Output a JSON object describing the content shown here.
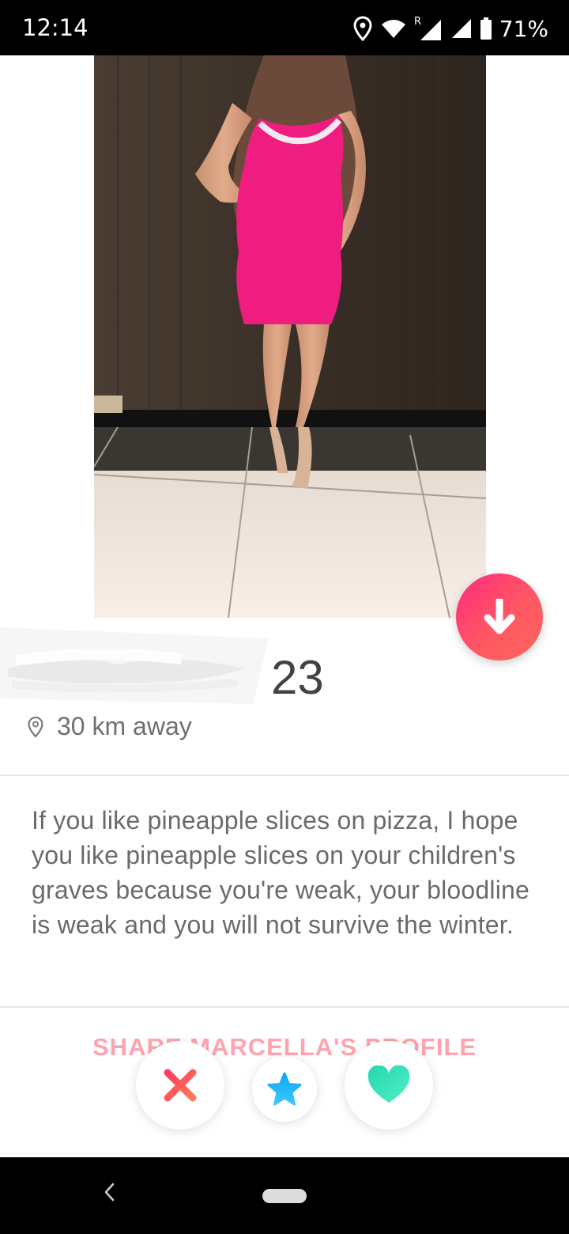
{
  "status_bar": {
    "time": "12:14",
    "battery": "71%",
    "icons": [
      "location-icon",
      "wifi-icon",
      "signal-roaming-icon",
      "signal-icon",
      "battery-icon"
    ]
  },
  "profile": {
    "photo": "profile-photo",
    "age": "23",
    "distance": "30 km away",
    "bio": "If you like pineapple slices on pizza, I hope you like pineapple slices on your children's graves because you're weak, your bloodline is weak and you will not survive the winter.",
    "share_label": "SHARE MARCELLA'S PROFILE"
  },
  "actions": {
    "nope_icon": "close-icon",
    "super_like_icon": "star-icon",
    "like_icon": "heart-icon",
    "collapse_icon": "arrow-down-icon"
  },
  "colors": {
    "brand": "#fd297b",
    "nope": "#ff4458",
    "super_like": "#1ab6ff",
    "like": "#3ce5b8"
  }
}
